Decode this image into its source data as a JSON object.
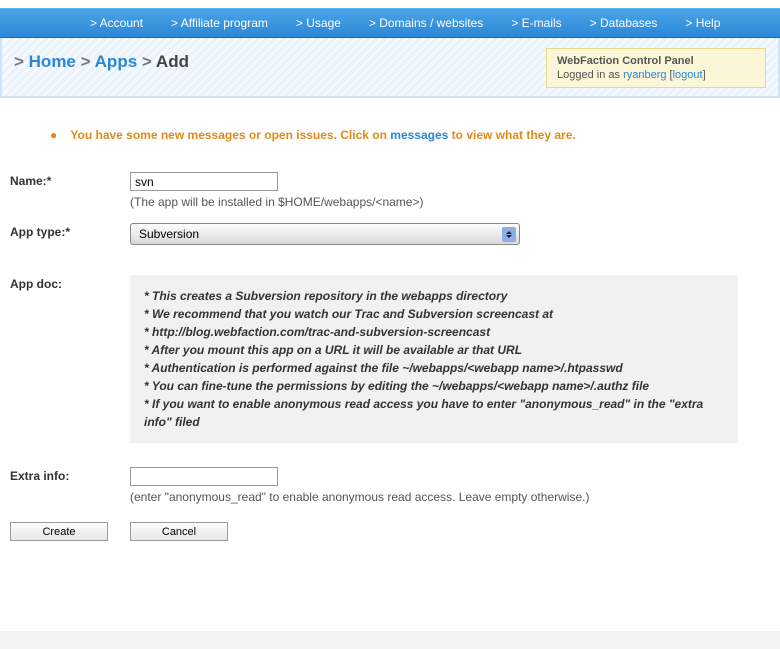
{
  "nav": [
    "> Account",
    "> Affiliate program",
    "> Usage",
    "> Domains / websites",
    "> E-mails",
    "> Databases",
    "> Help"
  ],
  "breadcrumb": {
    "home": "Home",
    "apps": "Apps",
    "add": "Add"
  },
  "userbox": {
    "title": "WebFaction Control Panel",
    "logged": "Logged in as ",
    "user": "ryanberg",
    "logout": "logout"
  },
  "notice": {
    "p1": "You have some new messages or open issues. Click on ",
    "link": "messages",
    "p2": " to view what they are."
  },
  "form": {
    "name_label": "Name:*",
    "name_value": "svn",
    "name_hint": "(The app will be installed in $HOME/webapps/<name>)",
    "type_label": "App type:*",
    "type_value": "Subversion",
    "doc_label": "App doc:",
    "doc_lines": [
      "* This creates a Subversion repository in the webapps directory",
      "* We recommend that you watch our Trac and Subversion screencast at",
      "* http://blog.webfaction.com/trac-and-subversion-screencast",
      "* After you mount this app on a URL it will be available ar that URL",
      "* Authentication is performed against the file ~/webapps/<webapp name>/.htpasswd",
      "* You can fine-tune the permissions by editing the ~/webapps/<webapp name>/.authz file",
      "* If you want to enable anonymous read access you have to enter \"anonymous_read\" in the \"extra info\" filed"
    ],
    "extra_label": "Extra info:",
    "extra_hint": "(enter \"anonymous_read\" to enable anonymous read access. Leave empty otherwise.)",
    "create": "Create",
    "cancel": "Cancel"
  }
}
